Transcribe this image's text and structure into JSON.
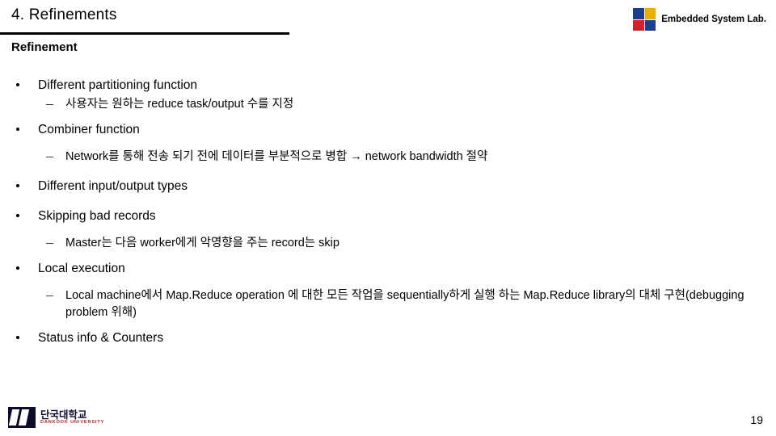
{
  "header": {
    "title": "4. Refinements",
    "lab_name": "Embedded System Lab.",
    "lab_icon": "four-square-logo-icon"
  },
  "section": {
    "heading": "Refinement"
  },
  "bullets": [
    {
      "level1": "Different partitioning function",
      "level2": [
        "사용자는 원하는 reduce task/output 수를 지정"
      ]
    },
    {
      "level1": "Combiner function",
      "level2": [
        "Network를 통해 전송 되기 전에 데이터를 부분적으로 병합 → network bandwidth 절약"
      ]
    },
    {
      "level1": "Different input/output types",
      "level2": []
    },
    {
      "level1": "Skipping bad records",
      "level2": [
        "Master는 다음 worker에게 악영향을 주는 record는 skip"
      ]
    },
    {
      "level1": "Local execution",
      "level2": [
        " Local machine에서 Map.Reduce operation 에 대한 모든 작업을 sequentially하게 실행 하는 Map.Reduce library의 대체 구현(debugging problem 위해)"
      ]
    },
    {
      "level1": "Status info & Counters",
      "level2": []
    }
  ],
  "footer": {
    "university_ko": "단국대학교",
    "university_en": "DANKOOK UNIVERSITY",
    "logo_icon": "dku-logo-icon",
    "page_number": "19"
  },
  "colors": {
    "rule": "#000000",
    "logo_blue": "#1a3f8f",
    "logo_yellow": "#e8b000",
    "logo_red": "#d81f26",
    "dku_navy": "#0b0b2e",
    "dku_red": "#b01f24"
  }
}
